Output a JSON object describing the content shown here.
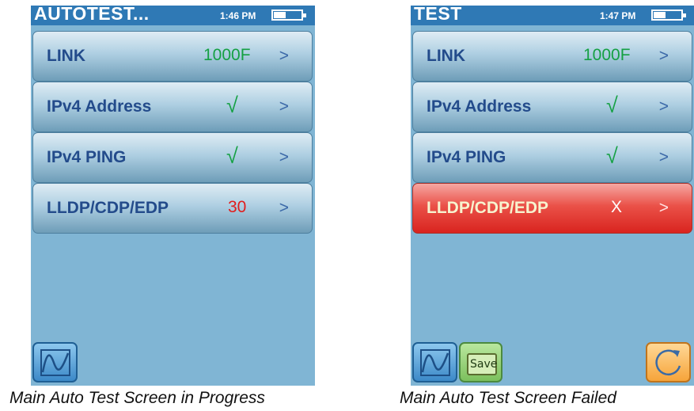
{
  "screens": [
    {
      "status": {
        "title": "AUTOTEST...",
        "time": "1:46 PM"
      },
      "rows": [
        {
          "label": "LINK",
          "value": "1000F",
          "arrow": ">"
        },
        {
          "label": "IPv4 Address",
          "value": "√",
          "arrow": ">"
        },
        {
          "label": "IPv4 PING",
          "value": "√",
          "arrow": ">"
        },
        {
          "label": "LLDP/CDP/EDP",
          "value": "30",
          "arrow": ">"
        }
      ],
      "caption": "Main Auto Test Screen in Progress"
    },
    {
      "status": {
        "title": "TEST",
        "time": "1:47 PM"
      },
      "rows": [
        {
          "label": "LINK",
          "value": "1000F",
          "arrow": ">"
        },
        {
          "label": "IPv4 Address",
          "value": "√",
          "arrow": ">"
        },
        {
          "label": "IPv4 PING",
          "value": "√",
          "arrow": ">"
        },
        {
          "label": "LLDP/CDP/EDP",
          "value": "X",
          "arrow": ">"
        }
      ],
      "buttons": {
        "save_label": "Save"
      },
      "caption": "Main Auto Test Screen Failed"
    }
  ],
  "colors": {
    "screen_bg": "#80b5d4",
    "status_bar": "#2f79b5",
    "pass_green": "#15a043",
    "countdown_red": "#e11d1d",
    "fail_row_red": "#e23a32"
  },
  "icons": [
    "graph-icon",
    "folder-icon",
    "refresh-icon",
    "battery-icon"
  ]
}
